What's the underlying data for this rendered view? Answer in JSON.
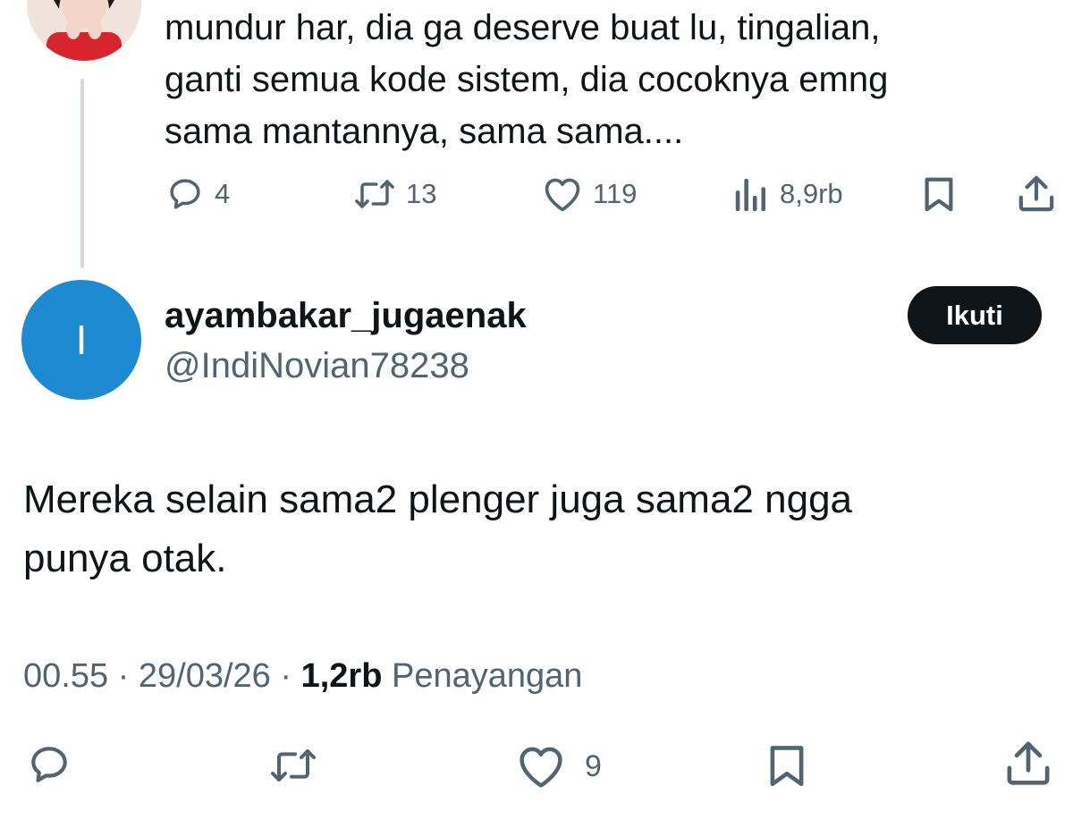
{
  "parent_tweet": {
    "text_lines": [
      "mundur har, dia ga deserve buat lu, tingalian,",
      "ganti semua kode sistem, dia cocoknya emng",
      "sama mantannya, sama sama...."
    ],
    "actions": {
      "reply_count": "4",
      "repost_count": "13",
      "like_count": "119",
      "view_count": "8,9rb"
    }
  },
  "reply_tweet": {
    "avatar_initial": "I",
    "avatar_color": "#1d8ad2",
    "display_name": "ayambakar_jugaenak",
    "handle": "@IndiNovian78238",
    "follow_label": "Ikuti",
    "text_lines": [
      "Mereka selain sama2 plenger juga sama2 ngga",
      "punya otak."
    ],
    "meta": {
      "time": "00.55",
      "date": "29/03/26",
      "views": "1,2rb",
      "views_label": "Penayangan",
      "separator": "·"
    },
    "actions": {
      "like_count": "9"
    }
  },
  "colors": {
    "text_primary": "#0f1419",
    "text_secondary": "#536471",
    "thread_line": "#cfd9de",
    "button_bg": "#0f1419"
  }
}
